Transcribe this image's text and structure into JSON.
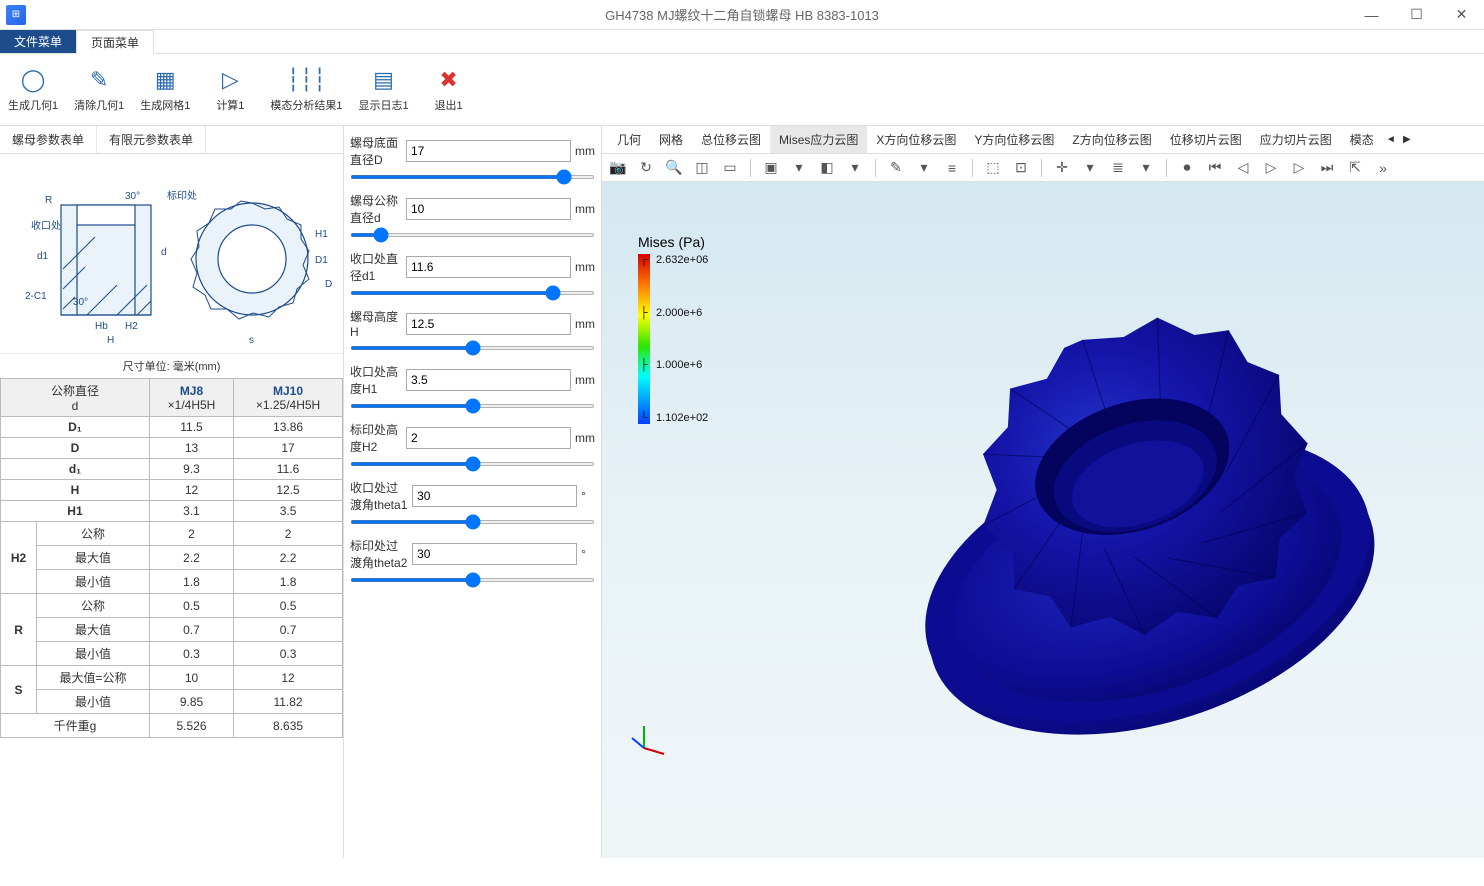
{
  "window": {
    "title": "GH4738 MJ螺纹十二角自锁螺母 HB 8383-1013",
    "min": "—",
    "max": "☐",
    "close": "✕"
  },
  "menubar": {
    "file": "文件菜单",
    "page": "页面菜单"
  },
  "ribbon": [
    {
      "label": "生成几何1",
      "icon": "◯",
      "color": "#2b6cb0"
    },
    {
      "label": "清除几何1",
      "icon": "✎",
      "color": "#2b6cb0"
    },
    {
      "label": "生成网格1",
      "icon": "▦",
      "color": "#2b6cb0"
    },
    {
      "label": "计算1",
      "icon": "▷",
      "color": "#2b6cb0"
    },
    {
      "label": "模态分析结果1",
      "icon": "┆┆┆",
      "color": "#2b6cb0"
    },
    {
      "label": "显示日志1",
      "icon": "▤",
      "color": "#2b6cb0"
    },
    {
      "label": "退出1",
      "icon": "✖",
      "color": "#d33"
    }
  ],
  "left_tabs": [
    "螺母参数表单",
    "有限元参数表单"
  ],
  "diagram_caption": "尺寸单位: 毫米(mm)",
  "diagram_labels": {
    "R": "R",
    "d1": "d1",
    "C1": "2-C1",
    "mark": "标印处",
    "collet": "收口处",
    "Hb": "Hb",
    "H2": "H2",
    "H": "H",
    "d": "d",
    "s": "s",
    "H1": "H1",
    "D1": "D1",
    "D": "D",
    "ang1": "30°",
    "ang2": "30°"
  },
  "spec_header": {
    "c0a": "公称直径",
    "c0b": "d",
    "c1": "MJ8",
    "c1b": "×1/4H5H",
    "c2": "MJ10",
    "c2b": "×1.25/4H5H"
  },
  "spec_rows": [
    {
      "h": "D₁",
      "a": "11.5",
      "b": "13.86"
    },
    {
      "h": "D",
      "a": "13",
      "b": "17"
    },
    {
      "h": "d₁",
      "a": "9.3",
      "b": "11.6"
    },
    {
      "h": "H",
      "a": "12",
      "b": "12.5"
    },
    {
      "h": "H1",
      "a": "3.1",
      "b": "3.5"
    }
  ],
  "spec_groups": [
    {
      "g": "H2",
      "rows": [
        {
          "h": "公称",
          "a": "2",
          "b": "2"
        },
        {
          "h": "最大值",
          "a": "2.2",
          "b": "2.2"
        },
        {
          "h": "最小值",
          "a": "1.8",
          "b": "1.8"
        }
      ]
    },
    {
      "g": "R",
      "rows": [
        {
          "h": "公称",
          "a": "0.5",
          "b": "0.5"
        },
        {
          "h": "最大值",
          "a": "0.7",
          "b": "0.7"
        },
        {
          "h": "最小值",
          "a": "0.3",
          "b": "0.3"
        }
      ]
    },
    {
      "g": "S",
      "rows": [
        {
          "h": "最大值=公称",
          "a": "10",
          "b": "12"
        },
        {
          "h": "最小值",
          "a": "9.85",
          "b": "11.82"
        }
      ]
    }
  ],
  "spec_footer": {
    "h": "千件重g",
    "a": "5.526",
    "b": "8.635"
  },
  "params": [
    {
      "label": "螺母底面直径D",
      "value": "17",
      "unit": "mm",
      "pos": 90
    },
    {
      "label": "螺母公称直径d",
      "value": "10",
      "unit": "mm",
      "pos": 10
    },
    {
      "label": "收口处直径d1",
      "value": "11.6",
      "unit": "mm",
      "pos": 85
    },
    {
      "label": "螺母高度H",
      "value": "12.5",
      "unit": "mm",
      "pos": 50
    },
    {
      "label": "收口处高度H1",
      "value": "3.5",
      "unit": "mm",
      "pos": 50
    },
    {
      "label": "标印处高度H2",
      "value": "2",
      "unit": "mm",
      "pos": 50
    },
    {
      "label": "收口处过渡角theta1",
      "value": "30",
      "unit": "°",
      "pos": 50
    },
    {
      "label": "标印处过渡角theta2",
      "value": "30",
      "unit": "°",
      "pos": 50
    }
  ],
  "right_tabs": [
    "几何",
    "网格",
    "总位移云图",
    "Mises应力云图",
    "X方向位移云图",
    "Y方向位移云图",
    "Z方向位移云图",
    "位移切片云图",
    "应力切片云图",
    "模态"
  ],
  "right_tabs_active": 3,
  "viewer_toolbar": [
    "camera-icon",
    "refresh-icon",
    "zoom-icon",
    "select-box-icon",
    "ruler-icon",
    "sep",
    "cube-view-icon",
    "chev-icon",
    "cube-transparent-icon",
    "chev-icon",
    "sep",
    "wand-icon",
    "chev-icon",
    "highlight-icon",
    "sep",
    "select-window-icon",
    "fit-icon",
    "sep",
    "axis-icon",
    "chev-icon",
    "layers-icon",
    "chev-icon",
    "sep",
    "camera-rec-icon",
    "skip-start-icon",
    "prev-icon",
    "play-icon",
    "next-icon",
    "skip-end-icon",
    "export-icon",
    "more-icon"
  ],
  "legend": {
    "title": "Mises (Pa)",
    "ticks": [
      "2.632e+06",
      "2.000e+6",
      "1.000e+6",
      "1.102e+02"
    ]
  }
}
